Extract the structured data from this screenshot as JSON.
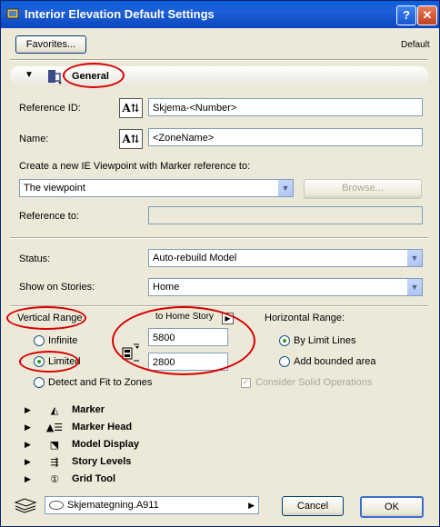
{
  "window": {
    "title": "Interior Elevation Default Settings",
    "help_glyph": "?",
    "close_glyph": "✕"
  },
  "toolbar": {
    "favorites_label": "Favorites...",
    "default_label": "Default"
  },
  "general": {
    "label": "General",
    "reference_id_label": "Reference ID:",
    "reference_id_value": "Skjema-<Number>",
    "name_label": "Name:",
    "name_value": "<ZoneName>",
    "create_label": "Create a new IE Viewpoint with Marker reference to:",
    "viewpoint_value": "The viewpoint",
    "browse_label": "Browse...",
    "reference_to_label": "Reference to:",
    "reference_to_value": "",
    "status_label": "Status:",
    "status_value": "Auto-rebuild Model",
    "show_on_stories_label": "Show on Stories:",
    "show_on_stories_value": "Home",
    "vertical_range_label": "Vertical Range",
    "infinite_label": "Infinite",
    "limited_label": "Limited",
    "detect_label": "Detect and Fit to Zones",
    "to_home_story_label": "to Home Story",
    "upper_value": "5800",
    "lower_value": "2800",
    "horizontal_range_label": "Horizontal Range:",
    "by_limit_lines_label": "By Limit Lines",
    "add_bounded_area_label": "Add bounded area",
    "consider_solid_label": "Consider Solid Operations",
    "icon_text": "A⇅"
  },
  "panels": [
    {
      "label": "Marker",
      "icon": "marker-icon",
      "glyph": "◭"
    },
    {
      "label": "Marker Head",
      "icon": "marker-head-icon",
      "glyph": "▲☰"
    },
    {
      "label": "Model Display",
      "icon": "model-display-icon",
      "glyph": "⬔"
    },
    {
      "label": "Story Levels",
      "icon": "story-levels-icon",
      "glyph": "⇶"
    },
    {
      "label": "Grid Tool",
      "icon": "grid-tool-icon",
      "glyph": "①"
    }
  ],
  "footer": {
    "layer_value": "Skjemategning.A911",
    "cancel_label": "Cancel",
    "ok_label": "OK"
  },
  "colors": {
    "titlebar": "#0b47c0",
    "highlight_ring": "#d80000",
    "radio_dot": "#21a121"
  }
}
